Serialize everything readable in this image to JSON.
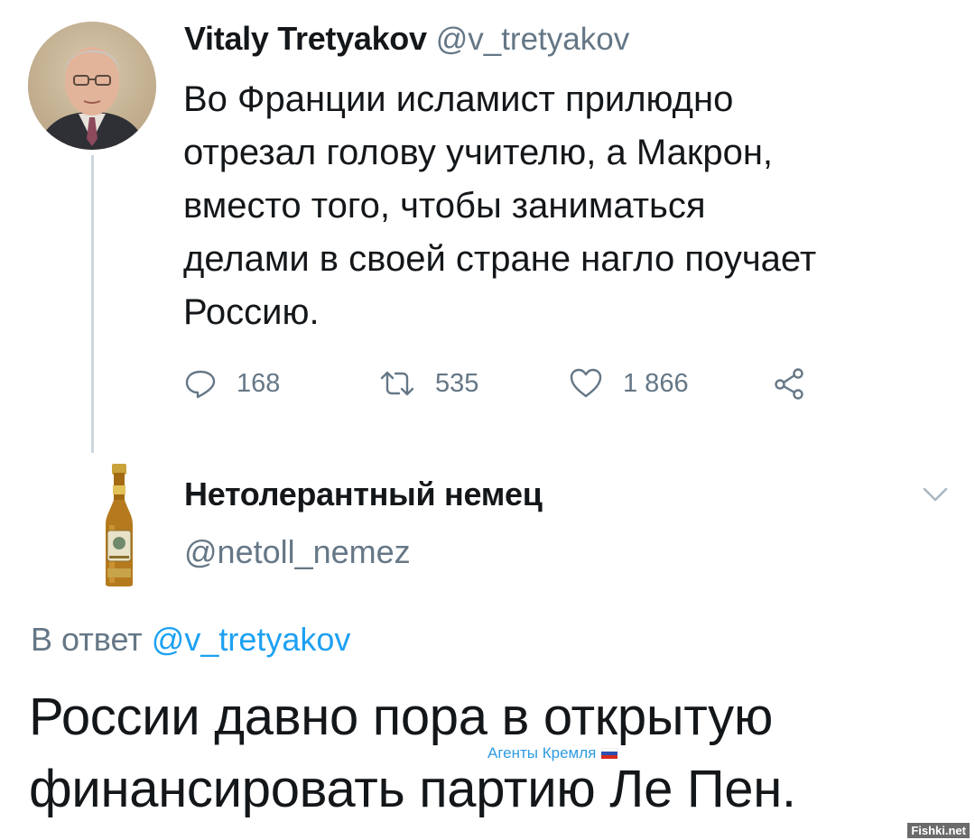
{
  "tweet": {
    "author": {
      "display_name": "Vitaly Tretyakov",
      "handle": "@v_tretyakov"
    },
    "text_lines": [
      "Во Франции исламист прилюдно",
      "отрезал голову учителю, а Макрон,",
      "вместо того, чтобы заниматься",
      "делами в своей стране нагло поучает",
      "Россию."
    ],
    "actions": {
      "replies": "168",
      "retweets": "535",
      "likes": "1 866",
      "reply_icon": "reply-icon",
      "retweet_icon": "retweet-icon",
      "like_icon": "heart-icon",
      "share_icon": "share-icon"
    }
  },
  "reply": {
    "author": {
      "display_name": "Нетолерантный немец",
      "handle": "@netoll_nemez",
      "avatar_icon": "beer-bottle-icon"
    },
    "reply_to_prefix": "В ответ",
    "reply_to_handle": "@v_tretyakov",
    "text_lines": [
      "России давно пора в открытую",
      "финансировать партию Ле Пен."
    ],
    "menu_icon": "chevron-down-icon"
  },
  "watermark": {
    "text": "Агенты Кремля",
    "flag_icon": "russian-flag-icon"
  },
  "site_mark": "Fishki.net",
  "colors": {
    "text": "#14171a",
    "secondary": "#657786",
    "link": "#1da1f2",
    "thread_line": "#ccd6dd"
  }
}
